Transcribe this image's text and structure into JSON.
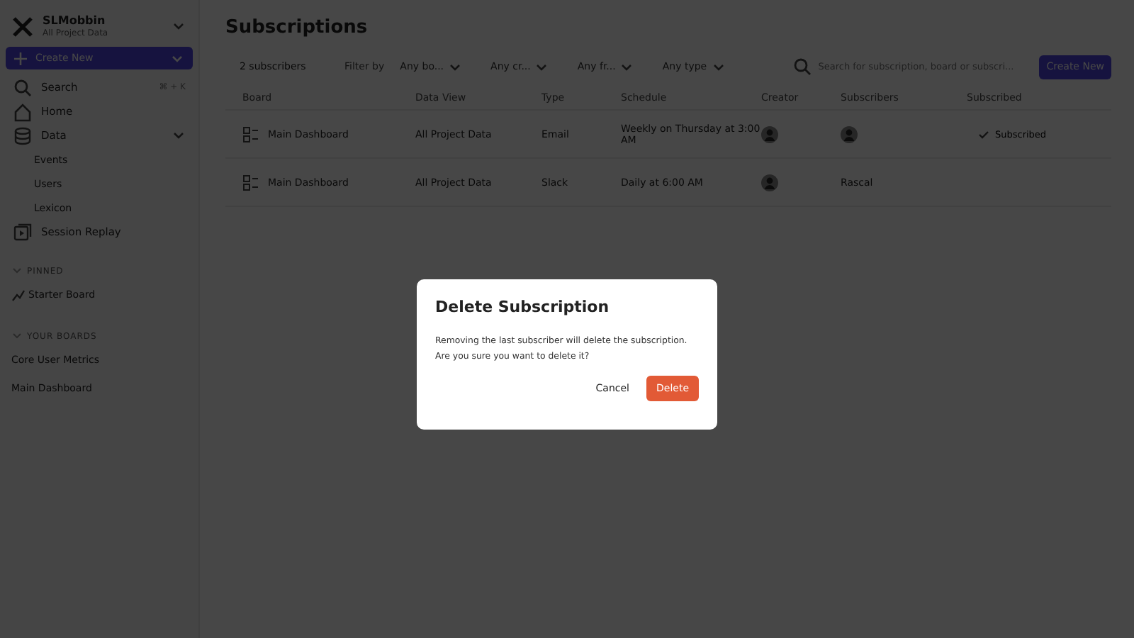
{
  "workspace": {
    "name": "SLMobbin",
    "project": "All Project Data"
  },
  "sidebar": {
    "create_button": "Create New",
    "items": [
      {
        "kind": "search",
        "label": "Search",
        "shortcut": "⌘ + K"
      },
      {
        "kind": "home",
        "label": "Home"
      },
      {
        "kind": "data",
        "label": "Data",
        "expanded": true,
        "children": [
          {
            "label": "Events"
          },
          {
            "label": "Users"
          },
          {
            "label": "Lexicon"
          }
        ]
      },
      {
        "kind": "replay",
        "label": "Session Replay"
      }
    ],
    "sections": [
      {
        "title": "PINNED",
        "expanded": true,
        "items": [
          {
            "kind": "starter",
            "label": "Starter Board"
          }
        ]
      },
      {
        "title": "YOUR BOARDS",
        "expanded": true,
        "items": [
          {
            "kind": "plain",
            "label": "Core User Metrics"
          },
          {
            "kind": "plain",
            "label": "Main Dashboard"
          }
        ]
      }
    ]
  },
  "page": {
    "title": "Subscriptions",
    "count": "2 subscribers",
    "filter_label": "Filter by",
    "filters": [
      "Any bo...",
      "Any cr...",
      "Any fr...",
      "Any type"
    ],
    "search": {
      "placeholder": "Search for subscription, board or subscri..."
    },
    "create_button": "Create New",
    "table": {
      "columns": [
        "Board",
        "Data View",
        "Type",
        "Schedule",
        "Creator",
        "Subscribers",
        "Subscribed"
      ],
      "rows": [
        {
          "board": "Main Dashboard",
          "data_view": "All Project Data",
          "type": "Email",
          "schedule": "Weekly on Thursday at 3:00 AM",
          "subscribers": {
            "kind": "avatar"
          },
          "subscribed": "Subscribed"
        },
        {
          "board": "Main Dashboard",
          "data_view": "All Project Data",
          "type": "Slack",
          "schedule": "Daily at 6:00 AM",
          "subscribers": {
            "kind": "text",
            "text": "Rascal"
          }
        }
      ]
    }
  },
  "dialog": {
    "title": "Delete Subscription",
    "message": "Removing the last subscriber will delete the subscription. Are you sure you want to delete it?",
    "cancel": "Cancel",
    "confirm": "Delete"
  }
}
